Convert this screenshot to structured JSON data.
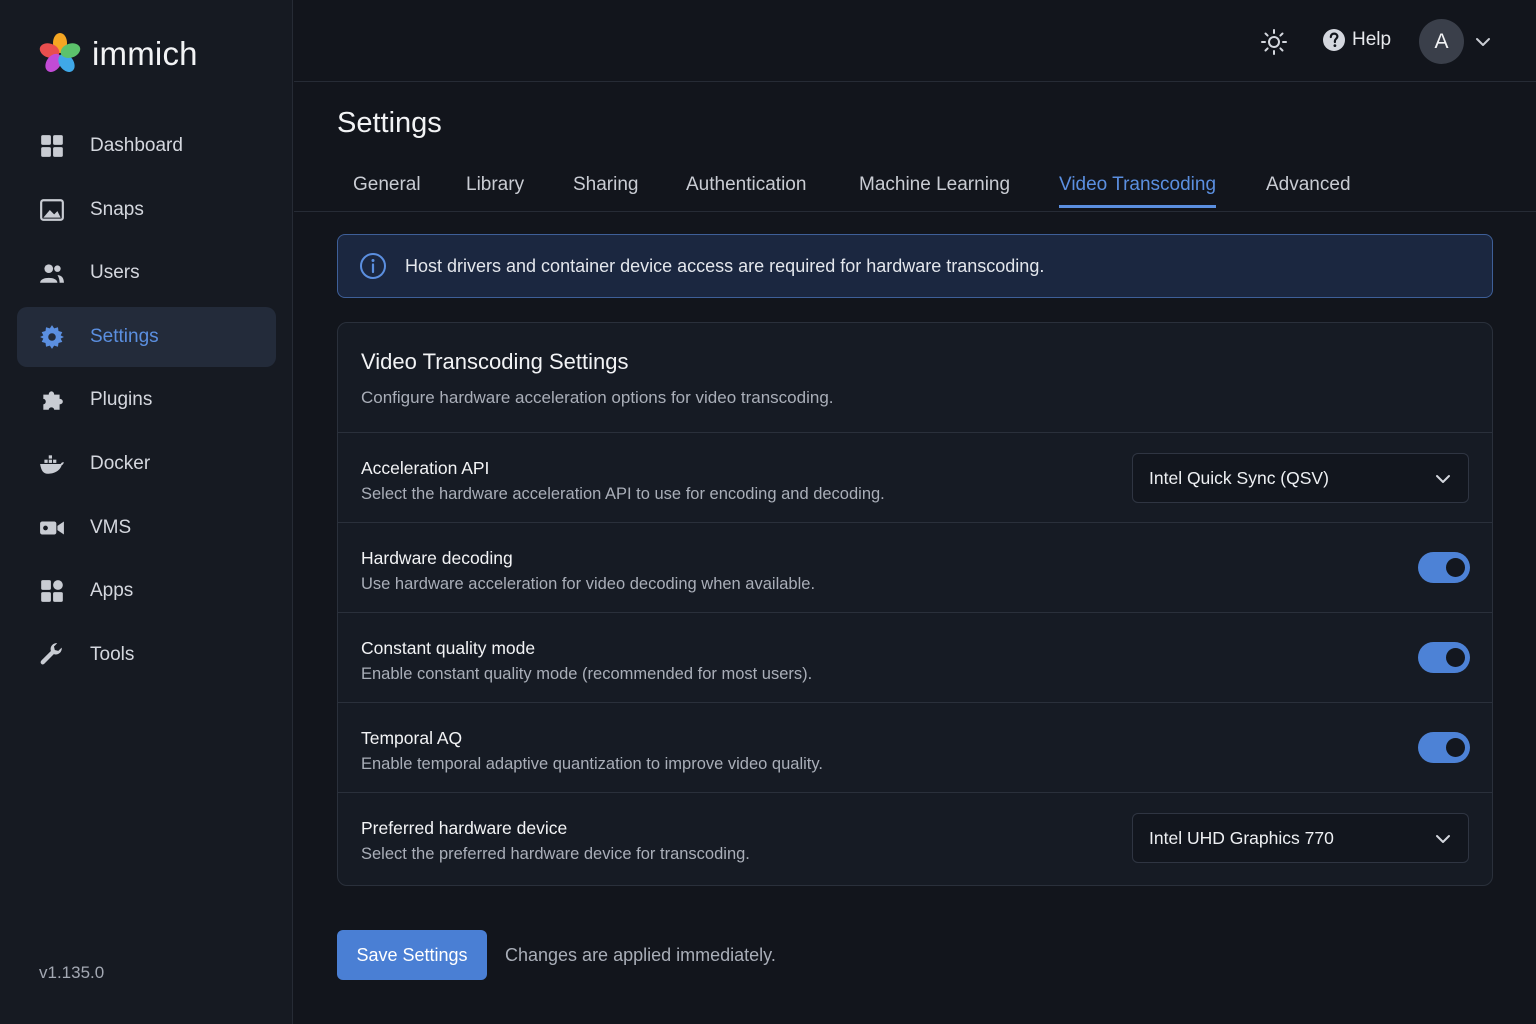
{
  "brand": {
    "name": "immich",
    "logo_icon": "immich-pinwheel-logo"
  },
  "sidebar": {
    "items": [
      {
        "label": "Dashboard",
        "icon": "dashboard-icon",
        "active": false
      },
      {
        "label": "Snaps",
        "icon": "image-icon",
        "active": false
      },
      {
        "label": "Users",
        "icon": "users-icon",
        "active": false
      },
      {
        "label": "Settings",
        "icon": "gear-icon",
        "active": true
      },
      {
        "label": "Plugins",
        "icon": "puzzle-icon",
        "active": false
      },
      {
        "label": "Docker",
        "icon": "docker-icon",
        "active": false
      },
      {
        "label": "VMS",
        "icon": "video-camera-icon",
        "active": false
      },
      {
        "label": "Apps",
        "icon": "apps-grid-icon",
        "active": false
      },
      {
        "label": "Tools",
        "icon": "wrench-icon",
        "active": false
      }
    ],
    "version": "v1.135.0"
  },
  "topbar": {
    "theme_icon": "sun-icon",
    "help_label": "Help",
    "avatar_initial": "A"
  },
  "page": {
    "title": "Settings",
    "tabs": [
      {
        "label": "General",
        "active": false
      },
      {
        "label": "Library",
        "active": false
      },
      {
        "label": "Sharing",
        "active": false
      },
      {
        "label": "Authentication",
        "active": false
      },
      {
        "label": "Machine Learning",
        "active": false
      },
      {
        "label": "Video Transcoding",
        "active": true
      },
      {
        "label": "Advanced",
        "active": false
      }
    ]
  },
  "info_banner": {
    "text": "Host drivers and container device access are required for hardware transcoding."
  },
  "card": {
    "title": "Video Transcoding Settings",
    "subtitle": "Configure hardware acceleration options for video transcoding.",
    "settings": {
      "acceleration_api": {
        "label": "Acceleration API",
        "description": "Select the hardware acceleration API to use for encoding and decoding.",
        "value": "Intel Quick Sync (QSV)"
      },
      "hardware_decoding": {
        "label": "Hardware decoding",
        "description": "Use hardware acceleration for video decoding when available.",
        "enabled": true
      },
      "constant_quality": {
        "label": "Constant quality mode",
        "description": "Enable constant quality mode (recommended for most users).",
        "enabled": true
      },
      "temporal_aq": {
        "label": "Temporal AQ",
        "description": "Enable temporal adaptive quantization to improve video quality.",
        "enabled": true
      },
      "preferred_device": {
        "label": "Preferred hardware device",
        "description": "Select the preferred hardware device for transcoding.",
        "value": "Intel UHD Graphics 770"
      }
    }
  },
  "footer": {
    "save_label": "Save Settings",
    "note": "Changes are applied immediately."
  },
  "colors": {
    "accent": "#4a7fd4",
    "active_text": "#5b8fe0",
    "background": "#12151c"
  }
}
